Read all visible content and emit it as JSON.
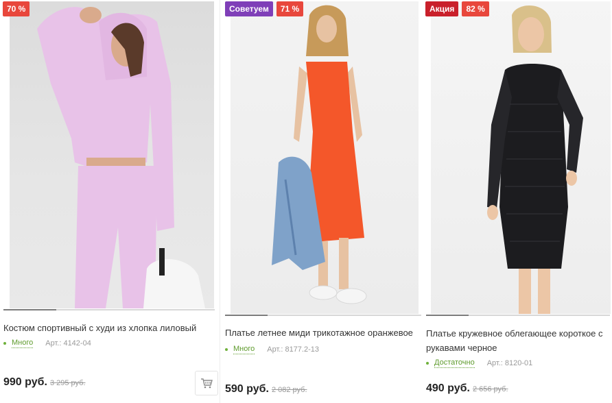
{
  "products": [
    {
      "badges": [
        "70 %"
      ],
      "title": "Костюм спортивный с худи из хлопка лиловый",
      "stock": "Много",
      "article": "Арт.: 4142-04",
      "price": "990 руб.",
      "old_price": "3 295 руб."
    },
    {
      "badges": [
        "Советуем",
        "71 %"
      ],
      "title": "Платье летнее миди трикотажное оранжевое",
      "stock": "Много",
      "article": "Арт.: 8177.2-13",
      "price": "590 руб.",
      "old_price": "2 082 руб."
    },
    {
      "badges": [
        "Акция",
        "82 %"
      ],
      "title": "Платье кружевное облегающее короткое с рукавами черное",
      "stock": "Достаточно",
      "article": "Арт.: 8120-01",
      "price": "490 руб.",
      "old_price": "2 656 руб."
    }
  ],
  "icons": {
    "cart": "shopping-cart-icon"
  },
  "colors": {
    "discount_badge": "#e8473c",
    "recommend_badge": "#7f3fb8",
    "sale_badge": "#c9202b",
    "in_stock": "#5e9b2c"
  }
}
